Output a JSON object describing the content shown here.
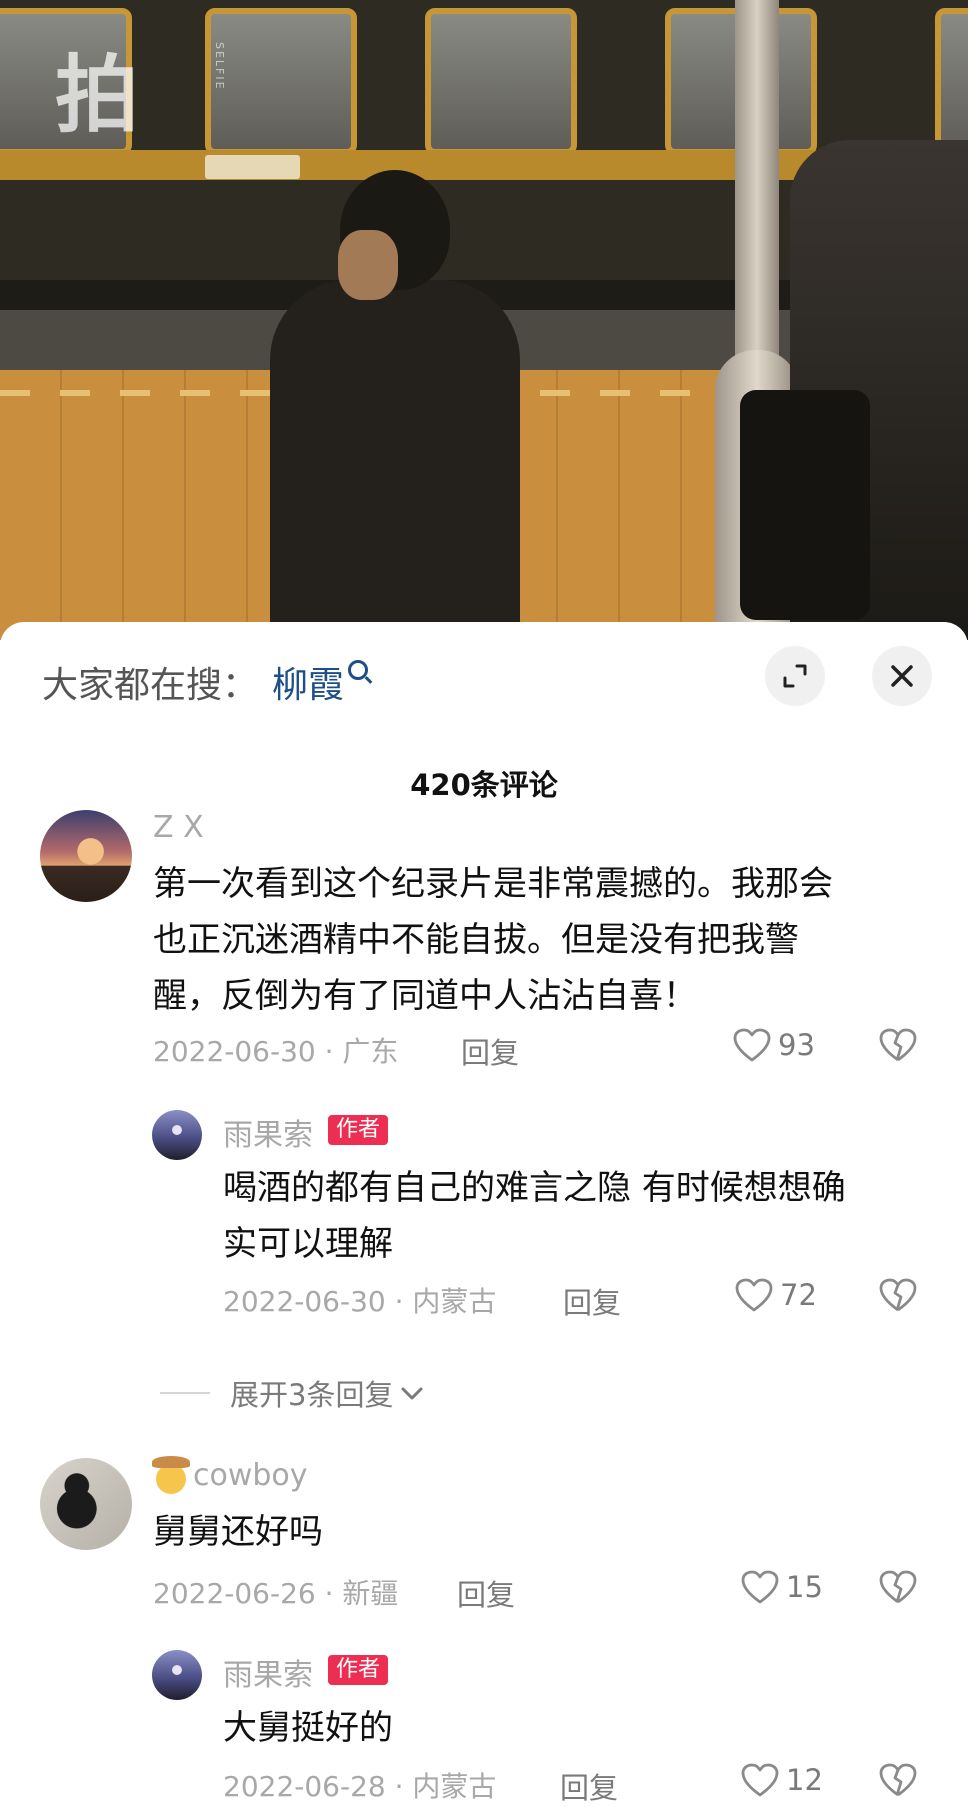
{
  "video": {
    "watermark": "拍",
    "watermark_sub": "SELFIE"
  },
  "search": {
    "prefix": "大家都在搜：",
    "term": "柳霞"
  },
  "header": {
    "comment_count": "420条评论"
  },
  "comments": [
    {
      "username": "Z X",
      "text_lines": [
        "第一次看到这个纪录片是非常震撼的。我那会",
        "也正沉迷酒精中不能自拔。但是没有把我警",
        "醒，反倒为有了同道中人沾沾自喜！"
      ],
      "meta": "2022-06-30 · 广东",
      "reply_label": "回复",
      "likes": "93"
    },
    {
      "username": "雨果索",
      "tag": "作者",
      "text_lines": [
        "喝酒的都有自己的难言之隐 有时候想想确",
        "实可以理解"
      ],
      "meta": "2022-06-30 · 内蒙古",
      "reply_label": "回复",
      "likes": "72"
    },
    {
      "username": "cowboy",
      "text_lines": [
        "舅舅还好吗"
      ],
      "meta": "2022-06-26 · 新疆",
      "reply_label": "回复",
      "likes": "15"
    },
    {
      "username": "雨果索",
      "tag": "作者",
      "text_lines": [
        "大舅挺好的"
      ],
      "meta": "2022-06-28 · 内蒙古",
      "reply_label": "回复",
      "likes": "12"
    }
  ],
  "expand_replies": {
    "label": "展开3条回复"
  },
  "colors": {
    "accent_link": "#1d4e89",
    "author_tag": "#ee2d52",
    "muted_text": "#a8a8a8"
  }
}
